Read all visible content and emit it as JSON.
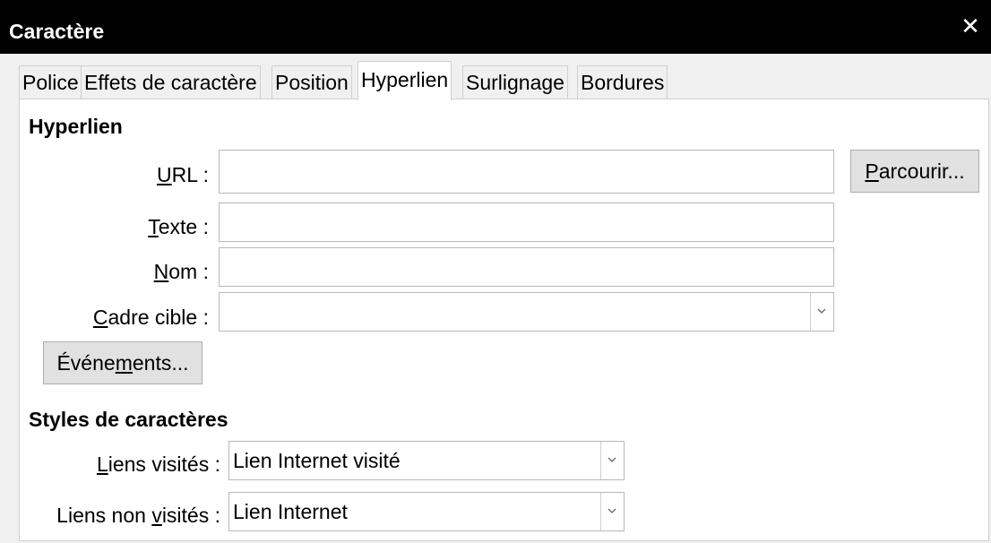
{
  "window": {
    "title": "Caractère",
    "close_icon": "close-icon"
  },
  "tabs": [
    {
      "label": "Police",
      "active": false
    },
    {
      "label": "Effets de caractère",
      "active": false
    },
    {
      "label": "Position",
      "active": false
    },
    {
      "label": "Hyperlien",
      "active": true
    },
    {
      "label": "Surlignage",
      "active": false
    },
    {
      "label": "Bordures",
      "active": false
    }
  ],
  "hyperlink": {
    "heading": "Hyperlien",
    "url": {
      "label_pre": "",
      "label_mnemonic": "U",
      "label_post": "RL :",
      "value": ""
    },
    "browse_button": {
      "mnemonic": "P",
      "rest": "arcourir..."
    },
    "text": {
      "label_pre": "",
      "label_mnemonic": "T",
      "label_post": "exte :",
      "value": ""
    },
    "name": {
      "label_pre": "",
      "label_mnemonic": "N",
      "label_post": "om :",
      "value": ""
    },
    "target_frame": {
      "label_pre": "",
      "label_mnemonic": "C",
      "label_post": "adre cible :",
      "value": ""
    },
    "events_button": {
      "pre": "Événe",
      "mnemonic": "m",
      "post": "ents..."
    }
  },
  "char_styles": {
    "heading": "Styles de caractères",
    "visited": {
      "label_pre": "",
      "label_mnemonic": "L",
      "label_post": "iens visités :",
      "value": "Lien Internet visité"
    },
    "unvisited": {
      "label_pre": "Liens non ",
      "label_mnemonic": "v",
      "label_post": "isités :",
      "value": "Lien Internet"
    }
  }
}
